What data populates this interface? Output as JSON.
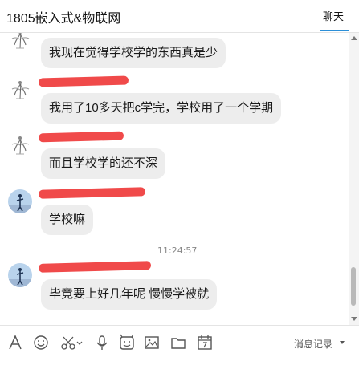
{
  "window": {
    "title": "1805嵌入式&物联网",
    "tab_label": "聊天"
  },
  "messages": [
    {
      "sender": "",
      "avatar": "sketch-avatar-icon",
      "text": "我现在觉得学校学的东西真是少"
    },
    {
      "sender": "",
      "avatar": "sketch-avatar-icon",
      "text": "我用了10多天把c学完，学校用了一个学期"
    },
    {
      "sender": "",
      "avatar": "sketch-avatar-icon",
      "text": "而且学校学的还不深"
    },
    {
      "sender": "",
      "avatar": "photo-avatar-icon",
      "text": "学校嘛"
    },
    {
      "sender": "",
      "avatar": "photo-avatar-icon",
      "text": "毕竟要上好几年呢  慢慢学被就"
    }
  ],
  "timestamp": "11:24:57",
  "toolbar": {
    "icons": [
      "font-icon",
      "emoji-icon",
      "scissors-icon",
      "microphone-icon",
      "sticker-icon",
      "image-icon",
      "folder-icon",
      "calendar-icon"
    ],
    "history_label": "消息记录"
  },
  "colors": {
    "accent": "#2b8fd8",
    "bubble": "#ededed",
    "redaction": "#ef3b3b"
  }
}
